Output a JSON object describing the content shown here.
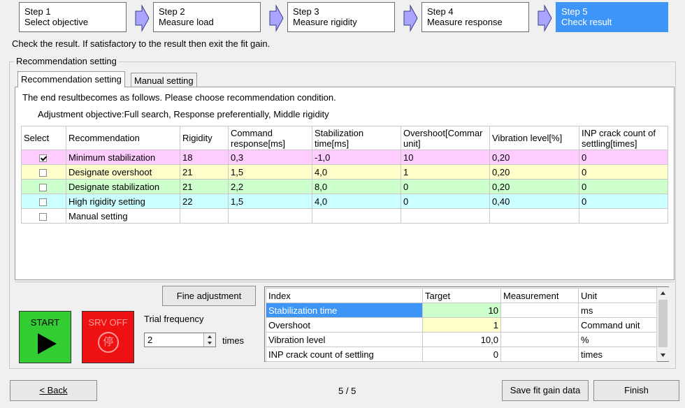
{
  "steps": [
    {
      "line1": "Step 1",
      "line2": "Select objective"
    },
    {
      "line1": "Step 2",
      "line2": "Measure load"
    },
    {
      "line1": "Step 3",
      "line2": "Measure rigidity"
    },
    {
      "line1": "Step 4",
      "line2": "Measure response"
    },
    {
      "line1": "Step 5",
      "line2": "Check result"
    }
  ],
  "instruction": "Check the result. If satisfactory to the result then exit the fit gain.",
  "group_title": "Recommendation setting",
  "tabs": [
    "Recommendation setting",
    "Manual setting"
  ],
  "result_text": "The end resultbecomes as follows. Please choose recommendation condition.",
  "objective_text": "Adjustment objective:Full search, Response preferentially, Middle rigidity",
  "table": {
    "headers": [
      "Select",
      "Recommendation",
      "Rigidity",
      "Command response[ms]",
      "Stabilization time[ms]",
      "Overshoot[Command unit]",
      "Vibration level[%]",
      "INP crack count of settling[times]"
    ],
    "header_lines": [
      [
        "Select"
      ],
      [
        "Recommendation"
      ],
      [
        "Rigidity"
      ],
      [
        "Command",
        "response[ms]"
      ],
      [
        "Stabilization",
        "time[ms]"
      ],
      [
        "Overshoot[Commar",
        "unit]"
      ],
      [
        "Vibration level[%]"
      ],
      [
        "INP crack count of",
        "settling[times]"
      ]
    ],
    "rows": [
      {
        "checked": true,
        "bg": "#ffccff",
        "name": "Minimum stabilization",
        "rigidity": "18",
        "command": "0,3",
        "stab": "-1,0",
        "overshoot": "10",
        "vibration": "0,20",
        "inp": "0"
      },
      {
        "checked": false,
        "bg": "#ffffcc",
        "name": "Designate overshoot",
        "rigidity": "21",
        "command": "1,5",
        "stab": "4,0",
        "overshoot": "1",
        "vibration": "0,20",
        "inp": "0"
      },
      {
        "checked": false,
        "bg": "#ccffcc",
        "name": "Designate stabilization",
        "rigidity": "21",
        "command": "2,2",
        "stab": "8,0",
        "overshoot": "0",
        "vibration": "0,20",
        "inp": "0"
      },
      {
        "checked": false,
        "bg": "#ccffff",
        "name": "High rigidity setting",
        "rigidity": "22",
        "command": "1,5",
        "stab": "4,0",
        "overshoot": "0",
        "vibration": "0,40",
        "inp": "0"
      },
      {
        "checked": false,
        "bg": "#ffffff",
        "name": "Manual setting",
        "rigidity": "",
        "command": "",
        "stab": "",
        "overshoot": "",
        "vibration": "",
        "inp": ""
      }
    ]
  },
  "fine_adjustment": "Fine adjustment",
  "start_label": "START",
  "srv_label": "SRV OFF",
  "srv_glyph": "停",
  "trial_label": "Trial frequency",
  "trial_value": "2",
  "times_label": "times",
  "index_table": {
    "headers": [
      "Index",
      "Target",
      "Measurement",
      "Unit"
    ],
    "rows": [
      {
        "index": "Stabilization time",
        "target": "10",
        "measurement": "",
        "unit": "ms",
        "selected": true,
        "target_bg": "#ccffcc"
      },
      {
        "index": "Overshoot",
        "target": "1",
        "measurement": "",
        "unit": "Command unit",
        "selected": false,
        "target_bg": "#ffffcc"
      },
      {
        "index": "Vibration level",
        "target": "10,0",
        "measurement": "",
        "unit": "%",
        "selected": false,
        "target_bg": "#ffffff"
      },
      {
        "index": "INP crack count of settling",
        "target": "0",
        "measurement": "",
        "unit": "times",
        "selected": false,
        "target_bg": "#ffffff"
      }
    ]
  },
  "back_label": "< Back",
  "page_indicator": "5 / 5",
  "save_label": "Save fit gain data",
  "finish_label": "Finish",
  "colors": {
    "active_step": "#3d95f7",
    "start_green": "#33cc33",
    "srv_red": "#ee1111",
    "selected_row": "#3d95f7"
  }
}
